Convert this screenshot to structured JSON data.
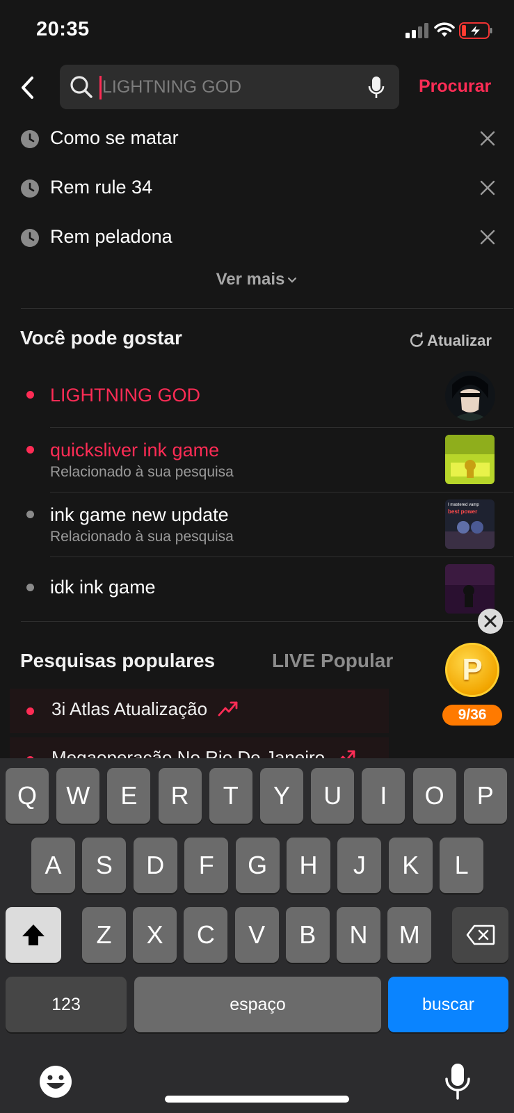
{
  "status_bar": {
    "time": "20:35"
  },
  "search": {
    "placeholder": "LIGHTNING GOD",
    "value": "",
    "submit_label": "Procurar"
  },
  "history": {
    "items": [
      {
        "label": "Como se matar"
      },
      {
        "label": "Rem rule 34"
      },
      {
        "label": "Rem peladona"
      }
    ],
    "see_more": "Ver mais"
  },
  "suggestions": {
    "title": "Você pode gostar",
    "refresh_label": "Atualizar",
    "items": [
      {
        "title": "LIGHTNING GOD",
        "subtitle": "",
        "highlight": true
      },
      {
        "title": "quicksliver ink game",
        "subtitle": "Relacionado à sua pesquisa",
        "highlight": true
      },
      {
        "title": "ink game new update",
        "subtitle": "Relacionado à sua pesquisa",
        "highlight": false,
        "thumb_text_1": "I mastered vamp",
        "thumb_text_2": "best power"
      },
      {
        "title": "idk ink game",
        "subtitle": "",
        "highlight": false
      }
    ]
  },
  "popular": {
    "tabs": [
      "Pesquisas populares",
      "LIVE Popular"
    ],
    "items": [
      {
        "label": "3i Atlas Atualização"
      },
      {
        "label": "Megaoperação No Rio De Janeiro"
      }
    ]
  },
  "coin_widget": {
    "symbol": "P",
    "progress": "9/36"
  },
  "keyboard": {
    "row1": [
      "Q",
      "W",
      "E",
      "R",
      "T",
      "Y",
      "U",
      "I",
      "O",
      "P"
    ],
    "row2": [
      "A",
      "S",
      "D",
      "F",
      "G",
      "H",
      "J",
      "K",
      "L"
    ],
    "row3": [
      "Z",
      "X",
      "C",
      "V",
      "B",
      "N",
      "M"
    ],
    "numbers_label": "123",
    "space_label": "espaço",
    "search_label": "buscar"
  },
  "colors": {
    "accent": "#fe2c55",
    "background": "#161616",
    "keyboard_blue": "#0a84ff"
  }
}
